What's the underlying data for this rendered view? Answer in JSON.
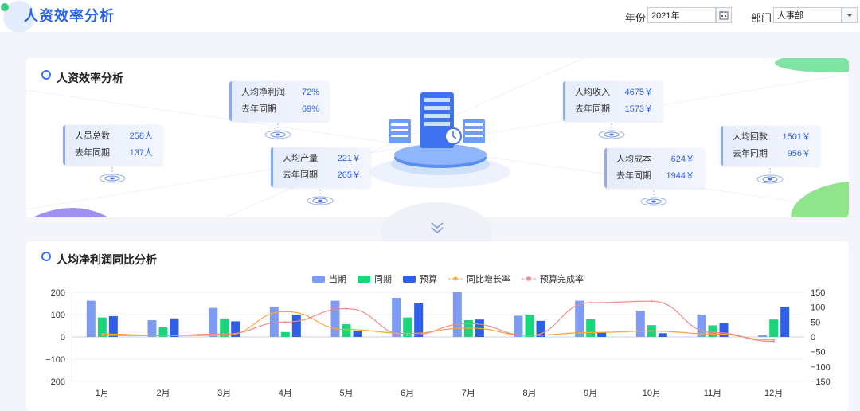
{
  "header": {
    "title": "人资效率分析"
  },
  "filters": {
    "year_label": "年份",
    "year_value": "2021年",
    "dept_label": "部门",
    "dept_value": "人事部"
  },
  "summary": {
    "title": "人资效率分析",
    "stats": [
      {
        "key": "net_profit",
        "label": "人均净利润",
        "value": "72%",
        "prev_label": "去年同期",
        "prev_value": "69%"
      },
      {
        "key": "headcount",
        "label": "人员总数",
        "value": "258人",
        "prev_label": "去年同期",
        "prev_value": "137人"
      },
      {
        "key": "output",
        "label": "人均产量",
        "value": "221￥",
        "prev_label": "去年同期",
        "prev_value": "265￥"
      },
      {
        "key": "income",
        "label": "人均收入",
        "value": "4675￥",
        "prev_label": "去年同期",
        "prev_value": "1573￥"
      },
      {
        "key": "cost",
        "label": "人均成本",
        "value": "624￥",
        "prev_label": "去年同期",
        "prev_value": "1944￥"
      },
      {
        "key": "collection",
        "label": "人均回款",
        "value": "1501￥",
        "prev_label": "去年同期",
        "prev_value": "956￥"
      }
    ]
  },
  "trend": {
    "title": "人均净利润同比分析"
  },
  "colors": {
    "current": "#7f9cf5",
    "same_period": "#1ad67a",
    "budget": "#2f5fe8",
    "yoy_rate": "#f6a73c",
    "budget_rate": "#f08a8a"
  },
  "chart_data": {
    "type": "bar",
    "categories": [
      "1月",
      "2月",
      "3月",
      "4月",
      "5月",
      "6月",
      "7月",
      "8月",
      "9月",
      "10月",
      "11月",
      "12月"
    ],
    "series": [
      {
        "name": "当期",
        "kind": "bar",
        "axis": "left",
        "values": [
          162,
          75,
          130,
          135,
          162,
          175,
          200,
          95,
          162,
          118,
          100,
          10
        ]
      },
      {
        "name": "同期",
        "kind": "bar",
        "axis": "left",
        "values": [
          87,
          43,
          83,
          22,
          57,
          87,
          75,
          100,
          80,
          53,
          52,
          78
        ]
      },
      {
        "name": "预算",
        "kind": "bar",
        "axis": "left",
        "values": [
          93,
          83,
          70,
          100,
          28,
          150,
          78,
          72,
          22,
          17,
          62,
          135
        ]
      },
      {
        "name": "同比增长率",
        "kind": "line",
        "axis": "right",
        "values": [
          10,
          5,
          5,
          85,
          25,
          12,
          30,
          5,
          15,
          20,
          10,
          -10
        ]
      },
      {
        "name": "预算完成率",
        "kind": "line",
        "axis": "right",
        "values": [
          5,
          5,
          10,
          50,
          95,
          5,
          45,
          5,
          115,
          120,
          15,
          -15
        ]
      }
    ],
    "ylim_left": [
      -200,
      200
    ],
    "yticks_left": [
      200,
      100,
      0,
      -100,
      -200
    ],
    "ylim_right": [
      -150,
      150
    ],
    "yticks_right": [
      150,
      100,
      50,
      0,
      -50,
      -100,
      -150
    ],
    "legend": "top-center"
  }
}
